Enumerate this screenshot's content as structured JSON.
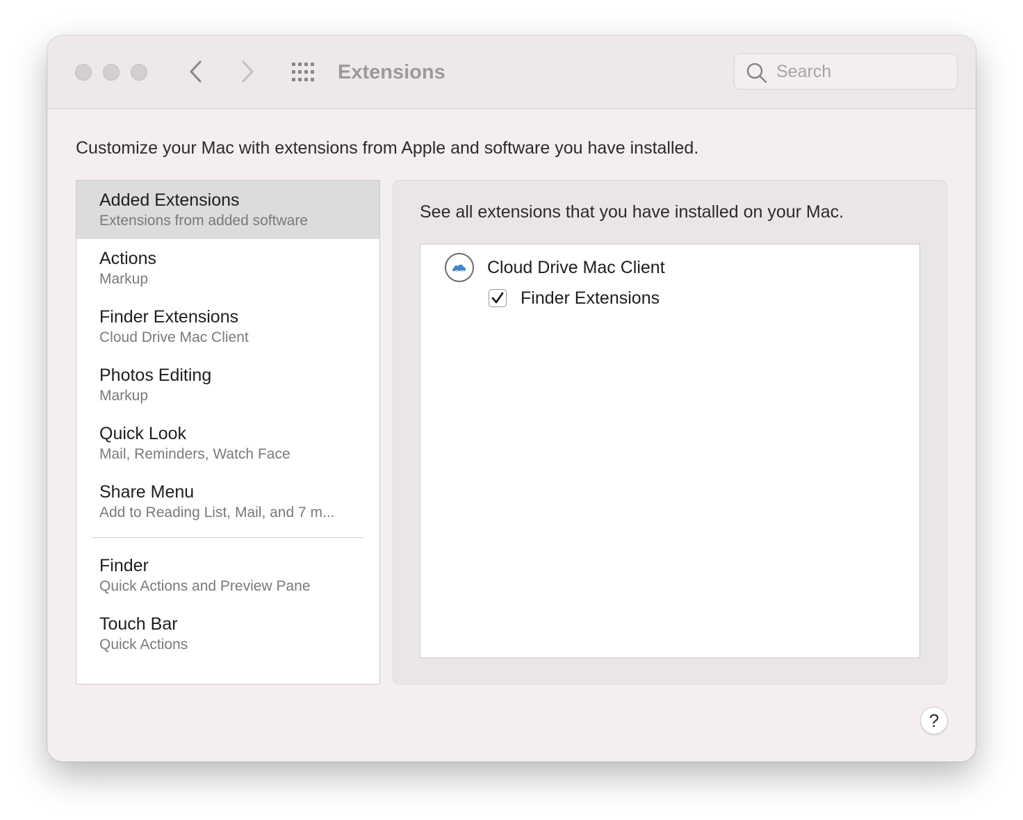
{
  "window": {
    "title": "Extensions",
    "description": "Customize your Mac with extensions from Apple and software you have installed."
  },
  "toolbar": {
    "back_icon": "chevron-left-icon",
    "forward_icon": "chevron-right-icon",
    "grid_icon": "grid-icon",
    "search": {
      "placeholder": "Search",
      "value": ""
    }
  },
  "sidebar": {
    "items": [
      {
        "title": "Added Extensions",
        "subtitle": "Extensions from added software",
        "selected": true
      },
      {
        "title": "Actions",
        "subtitle": "Markup"
      },
      {
        "title": "Finder Extensions",
        "subtitle": "Cloud Drive Mac Client"
      },
      {
        "title": "Photos Editing",
        "subtitle": "Markup"
      },
      {
        "title": "Quick Look",
        "subtitle": "Mail, Reminders, Watch Face"
      },
      {
        "title": "Share Menu",
        "subtitle": "Add to Reading List, Mail, and 7 m..."
      },
      {
        "title": "Finder",
        "subtitle": "Quick Actions and Preview Pane"
      },
      {
        "title": "Touch Bar",
        "subtitle": "Quick Actions"
      }
    ]
  },
  "detail": {
    "description": "See all extensions that you have installed on your Mac.",
    "app": {
      "name": "Cloud Drive Mac Client",
      "icon": "cloud-icon",
      "extension": {
        "label": "Finder Extensions",
        "checked": true
      }
    }
  },
  "help": {
    "label": "?"
  },
  "colors": {
    "window_bg": "#f4eeee",
    "selected_row": "#dcdcdc",
    "cloud_icon": "#3f87c9"
  }
}
